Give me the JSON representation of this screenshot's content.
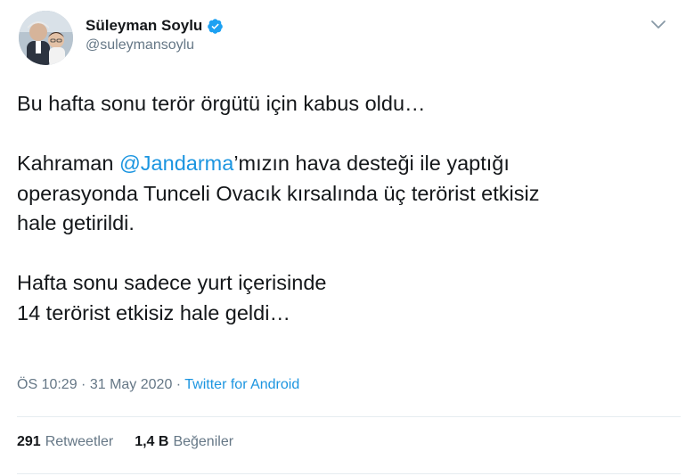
{
  "author": {
    "display_name": "Süleyman Soylu",
    "handle": "@suleymansoylu",
    "verified": true,
    "avatar_icon": "profile-photo",
    "verified_icon": "verified-badge-icon"
  },
  "tweet": {
    "line1": "Bu hafta sonu terör örgütü için kabus oldu…",
    "line2_before": "Kahraman ",
    "line2_mention": "@Jandarma",
    "line2_after": "’mızın hava desteği ile yaptığı",
    "line3": "operasyonda Tunceli Ovacık kırsalında üç terörist etkisiz",
    "line4": "hale getirildi.",
    "line5": "Hafta sonu sadece yurt içerisinde",
    "line6": "14 terörist etkisiz hale geldi…"
  },
  "meta": {
    "time": "ÖS 10:29",
    "separator1": " · ",
    "date": "31 May 2020",
    "separator2": " · ",
    "source": "Twitter for Android"
  },
  "stats": {
    "retweets_count": "291",
    "retweets_label": "Retweetler",
    "likes_count": "1,4 B",
    "likes_label": "Beğeniler"
  },
  "colors": {
    "link": "#1b95e0",
    "secondary_text": "#657786",
    "primary_text": "#14171a",
    "verified_badge": "#1da1f2"
  }
}
